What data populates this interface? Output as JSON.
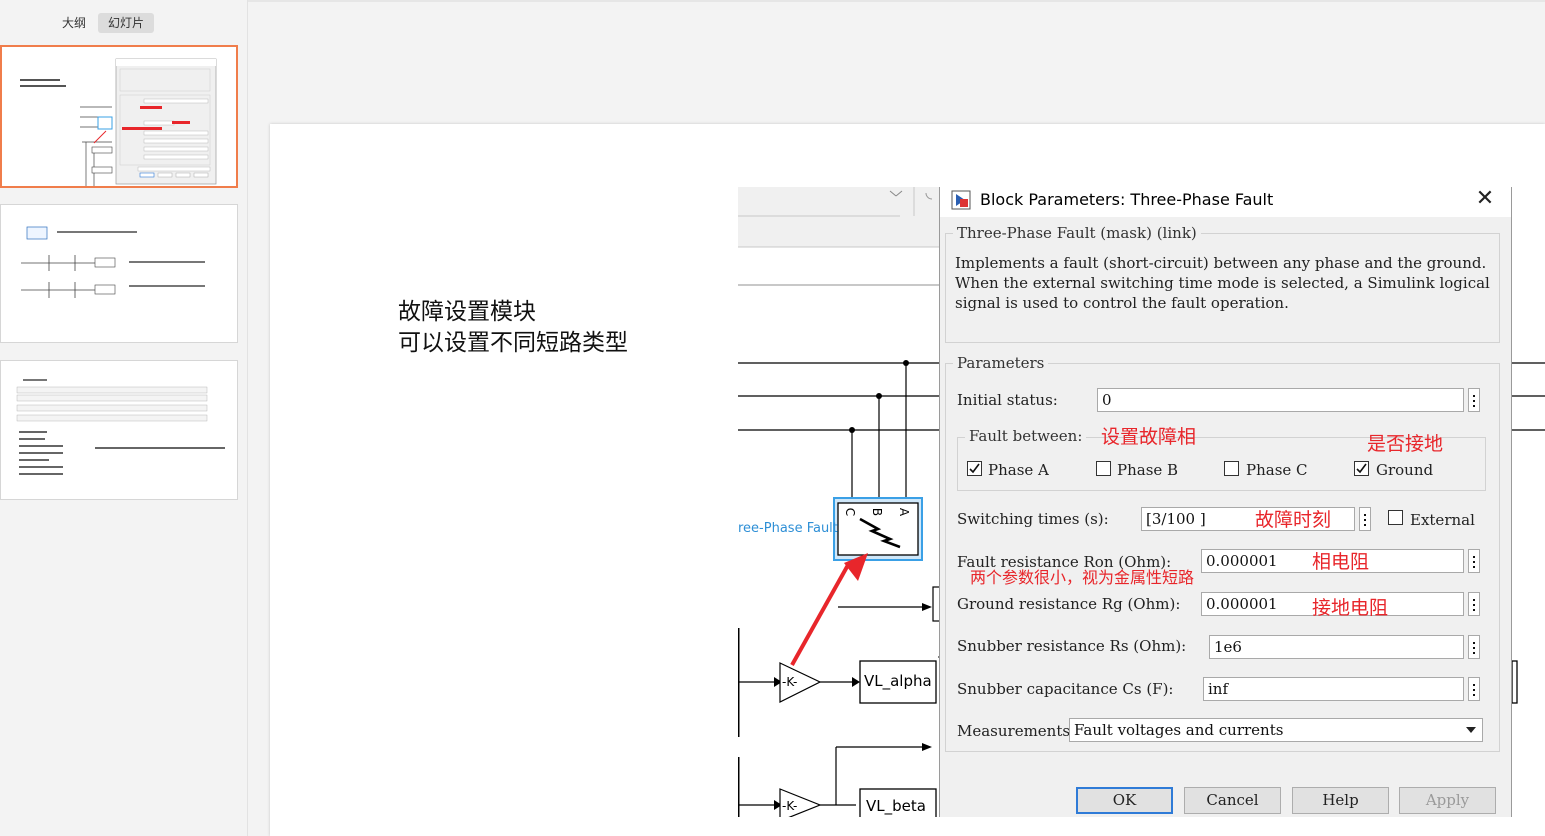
{
  "panel": {
    "tabs": [
      "大纲",
      "幻灯片"
    ]
  },
  "slide": {
    "text_line1": "故障设置模块",
    "text_line2": "可以设置不同短路类型"
  },
  "simulink": {
    "block_label": "ree-Phase Fault",
    "port_labels": [
      "C",
      "B",
      "A"
    ],
    "gain_label": "-K-",
    "vl_alpha": "VL_alpha",
    "vl_beta": "VL_beta"
  },
  "dialog": {
    "title": "Block Parameters: Three-Phase Fault",
    "header_legend": "Three-Phase Fault (mask) (link)",
    "description": "Implements a fault (short-circuit) between any phase and the ground. When the external switching time mode is selected, a Simulink logical signal is used to control the fault operation.",
    "params_legend": "Parameters",
    "initial_status_label": "Initial status:",
    "initial_status_value": "0",
    "fault_between_label": "Fault between:",
    "phase_a": "Phase A",
    "phase_b": "Phase B",
    "phase_c": "Phase C",
    "ground": "Ground",
    "phase_a_checked": true,
    "phase_b_checked": false,
    "phase_c_checked": false,
    "ground_checked": true,
    "switching_label": "Switching times (s):",
    "switching_value": "[3/100 ]",
    "external_label": "External",
    "external_checked": false,
    "ron_label": "Fault resistance Ron (Ohm):",
    "ron_value": "0.000001",
    "rg_label": "Ground resistance Rg (Ohm):",
    "rg_value": "0.000001",
    "rs_label": "Snubber resistance Rs (Ohm):",
    "rs_value": "1e6",
    "cs_label": "Snubber capacitance Cs (F):",
    "cs_value": "inf",
    "measurements_label": "Measurements",
    "measurements_value": "Fault voltages and currents",
    "buttons": {
      "ok": "OK",
      "cancel": "Cancel",
      "help": "Help",
      "apply": "Apply"
    }
  },
  "annotations": {
    "fault_phase": "设置故障相",
    "grounded": "是否接地",
    "fault_time": "故障时刻",
    "phase_resistance": "相电阻",
    "small_params": "两个参数很小，视为金属性短路",
    "ground_resistance": "接地电阻"
  },
  "colors": {
    "annotation_red": "#e8262b",
    "thumb_selected": "#f07d4b",
    "block_highlight": "#3aa0e6",
    "block_label_blue": "#2e8fd6",
    "ok_border": "#2f7bd7"
  }
}
